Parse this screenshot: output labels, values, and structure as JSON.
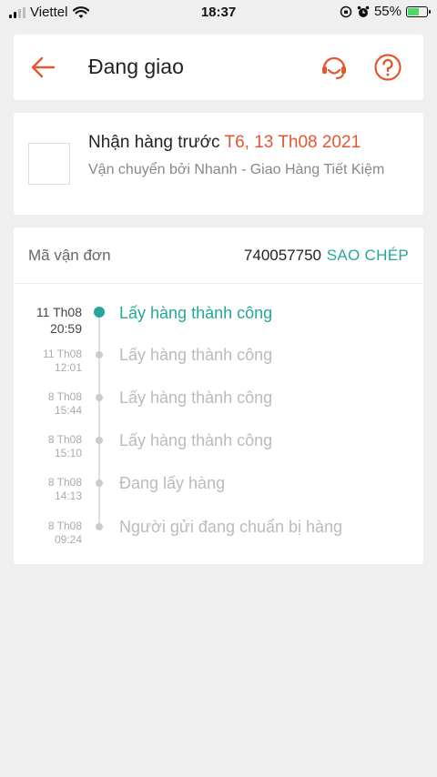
{
  "status_bar": {
    "carrier": "Viettel",
    "time": "18:37",
    "battery": "55%",
    "battery_level": 0.55
  },
  "header": {
    "title": "Đang giao"
  },
  "delivery": {
    "expected_label": "Nhận hàng trước",
    "expected_date": "T6, 13 Th08 2021",
    "carrier_text": "Vận chuyển bởi Nhanh  - Giao Hàng Tiết Kiệm"
  },
  "tracking": {
    "label": "Mã vận đơn",
    "number": "740057750",
    "copy_label": "SAO CHÉP",
    "events": [
      {
        "date": "11 Th08",
        "time": "20:59",
        "status": "Lấy hàng thành công"
      },
      {
        "date": "11 Th08",
        "time": "12:01",
        "status": "Lấy hàng thành công"
      },
      {
        "date": "8 Th08",
        "time": "15:44",
        "status": "Lấy hàng thành công"
      },
      {
        "date": "8 Th08",
        "time": "15:10",
        "status": "Lấy hàng thành công"
      },
      {
        "date": "8 Th08",
        "time": "14:13",
        "status": "Đang lấy hàng"
      },
      {
        "date": "8 Th08",
        "time": "09:24",
        "status": "Người gửi đang chuẩn bị hàng"
      }
    ]
  },
  "colors": {
    "accent": "#e4572e",
    "teal": "#26a69a",
    "background": "#efefef"
  }
}
